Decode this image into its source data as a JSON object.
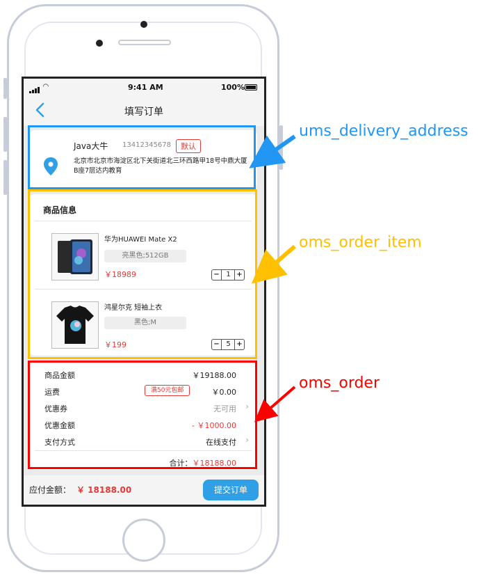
{
  "colors": {
    "accent": "#2f9fe6",
    "price_red": "#e53935",
    "annot_blue": "#2196f3",
    "annot_yellow": "#ffc000",
    "annot_red": "#ff0000"
  },
  "status_bar": {
    "time": "9:41 AM",
    "battery": "100%"
  },
  "nav": {
    "back_icon": "chevron-left-icon",
    "title": "填写订单"
  },
  "address": {
    "name": "Java大牛",
    "phone": "13412345678",
    "badge": "默认",
    "detail": "北京市北京市海淀区北下关街道北三环西路甲18号中鼎大厦B座7层达内教育",
    "icon": "location-pin-icon"
  },
  "items": {
    "section_title": "商品信息",
    "list": [
      {
        "name": "华为HUAWEI Mate X2",
        "spec": "亮黑色;512GB",
        "price": "￥18989",
        "qty": "1",
        "image_icon": "phone-product-image"
      },
      {
        "name": "鸿星尔克 短袖上衣",
        "spec": "黑色;M",
        "price": "￥199",
        "qty": "5",
        "image_icon": "tshirt-product-image"
      }
    ],
    "minus": "−",
    "plus": "+"
  },
  "order": {
    "goods_amount_label": "商品金额",
    "goods_amount": "￥19188.00",
    "freight_label": "运费",
    "freight_promo": "满50元包邮",
    "freight": "￥0.00",
    "coupon_label": "优惠券",
    "coupon": "无可用",
    "discount_label": "优惠金额",
    "discount": "- ￥1000.00",
    "payment_label": "支付方式",
    "payment": "在线支付",
    "total_label": "合计：",
    "total": "￥18188.00"
  },
  "bottom": {
    "pay_label": "应付金额：",
    "pay_amount": "￥ 18188.00",
    "submit": "提交订单"
  },
  "annotations": {
    "address_table": "ums_delivery_address",
    "item_table": "oms_order_item",
    "order_table": "oms_order"
  }
}
